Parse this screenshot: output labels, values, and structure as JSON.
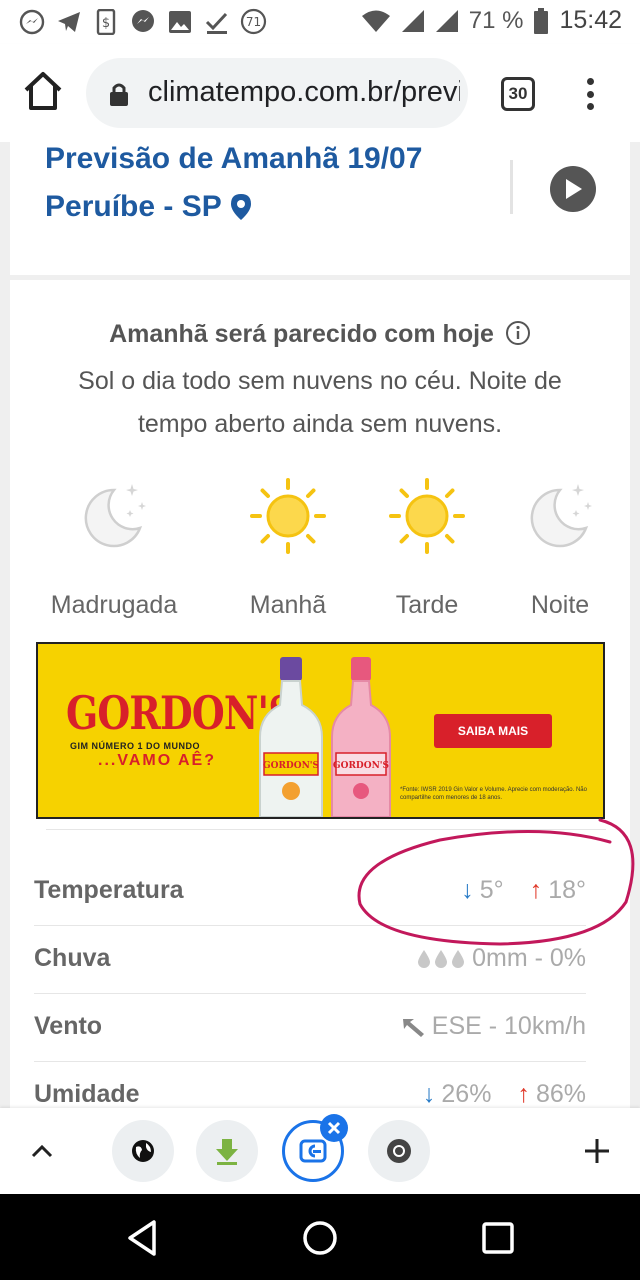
{
  "status_bar": {
    "notification_badge": "71",
    "battery_percent": "71 %",
    "time": "15:42"
  },
  "browser": {
    "url": "climatempo.com.br/previsao",
    "tab_count": "30"
  },
  "forecast": {
    "title": "Previsão de Amanhã 19/07",
    "location": "Peruíbe - SP",
    "summary_title": "Amanhã será parecido com hoje",
    "summary_text": "Sol o dia todo sem nuvens no céu. Noite de tempo aberto ainda sem nuvens.",
    "periods": [
      {
        "label": "Madrugada",
        "icon": "moon-stars-icon"
      },
      {
        "label": "Manhã",
        "icon": "sun-icon"
      },
      {
        "label": "Tarde",
        "icon": "sun-icon"
      },
      {
        "label": "Noite",
        "icon": "moon-stars-icon"
      }
    ]
  },
  "ad": {
    "brand": "GORDON'S",
    "subtitle": "GIM NÚMERO 1 DO MUNDO",
    "slogan": "...VAMO AÊ?",
    "cta": "SAIBA MAIS",
    "fine_print": "*Fonte: IWSR 2019 Gin Valor e Volume. Aprecie com moderação. Não compartilhe com menores de 18 anos."
  },
  "details": {
    "temperature": {
      "label": "Temperatura",
      "min": "5°",
      "max": "18°"
    },
    "rain": {
      "label": "Chuva",
      "value": "0mm - 0%"
    },
    "wind": {
      "label": "Vento",
      "value": "ESE - 10km/h"
    },
    "humidity": {
      "label": "Umidade",
      "min": "26%",
      "max": "86%"
    }
  },
  "colors": {
    "title_blue": "#1e5aa0",
    "min_arrow": "#2a7cc7",
    "max_arrow": "#e03b2c",
    "annotation": "#c2185b",
    "ad_yellow": "#f6d200"
  }
}
